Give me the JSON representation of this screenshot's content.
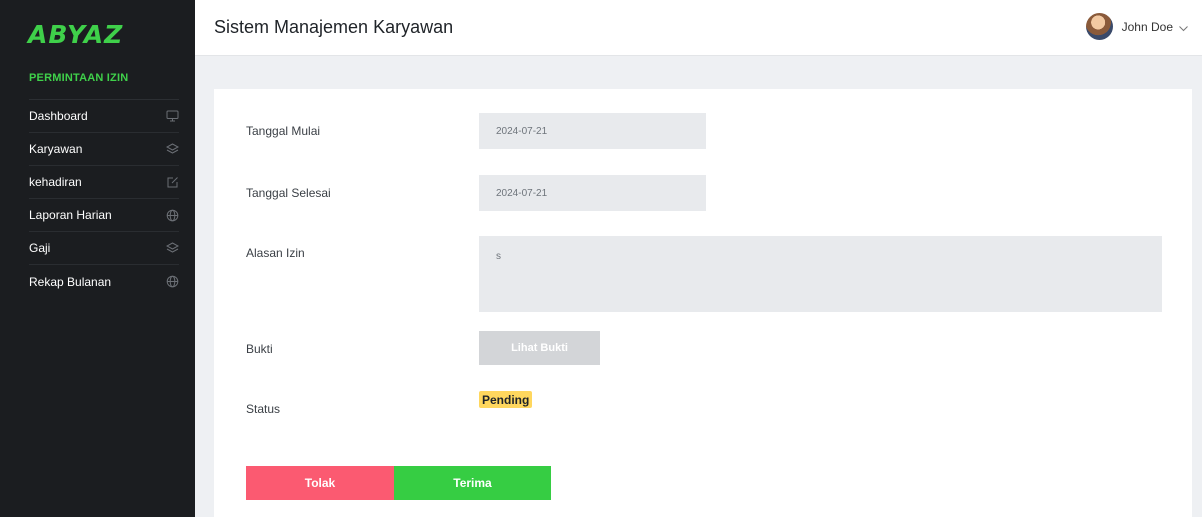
{
  "app": {
    "logo_text": "ABYAZ",
    "title": "Sistem Manajemen Karyawan"
  },
  "user": {
    "name": "John Doe"
  },
  "sidebar": {
    "section_header": "PERMINTAAN IZIN",
    "items": [
      {
        "label": "Dashboard",
        "icon": "monitor-icon"
      },
      {
        "label": "Karyawan",
        "icon": "layers-icon"
      },
      {
        "label": "kehadiran",
        "icon": "edit-icon"
      },
      {
        "label": "Laporan Harian",
        "icon": "globe-icon"
      },
      {
        "label": "Gaji",
        "icon": "layers-icon"
      },
      {
        "label": "Rekap Bulanan",
        "icon": "globe-icon"
      }
    ]
  },
  "form": {
    "tanggal_mulai": {
      "label": "Tanggal Mulai",
      "value": "2024-07-21"
    },
    "tanggal_selesai": {
      "label": "Tanggal Selesai",
      "value": "2024-07-21"
    },
    "alasan_izin": {
      "label": "Alasan Izin",
      "value": "s"
    },
    "bukti": {
      "label": "Bukti",
      "button_label": "Lihat Bukti"
    },
    "status": {
      "label": "Status",
      "value": "Pending"
    }
  },
  "actions": {
    "reject_label": "Tolak",
    "accept_label": "Terima"
  },
  "colors": {
    "sidebar_bg": "#1b1d20",
    "accent_green": "#3fd04a",
    "reject": "#fb5a71",
    "accept": "#36cd43",
    "pending_badge": "#ffd75e"
  }
}
